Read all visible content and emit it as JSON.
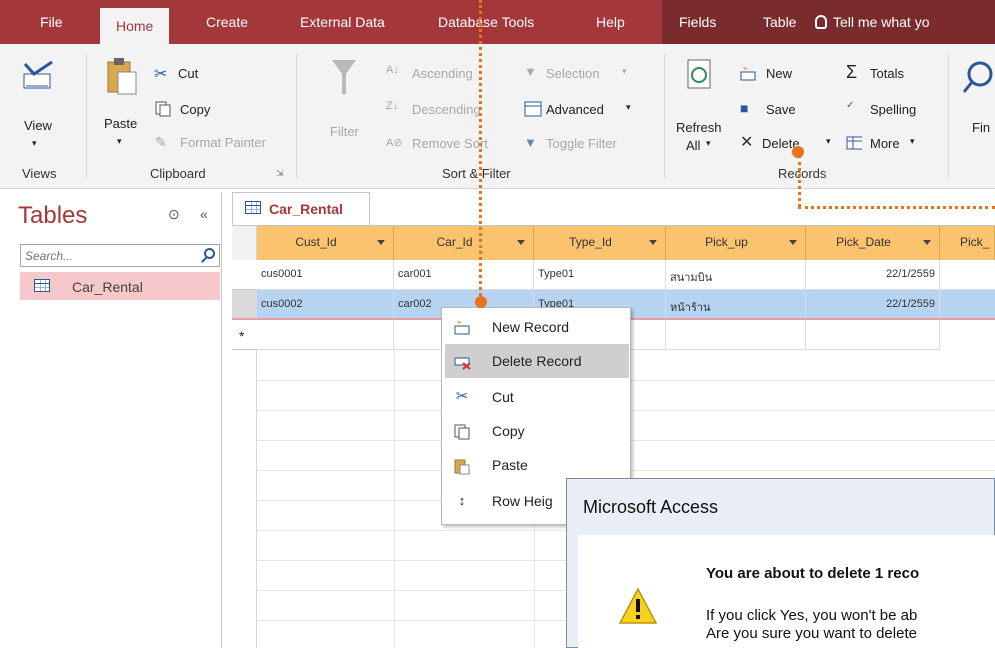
{
  "tabs": [
    {
      "label": "File"
    },
    {
      "label": "Home"
    },
    {
      "label": "Create"
    },
    {
      "label": "External Data"
    },
    {
      "label": "Database Tools"
    },
    {
      "label": "Help"
    },
    {
      "label": "Fields"
    },
    {
      "label": "Table"
    }
  ],
  "tell_me": "Tell me what yo",
  "ribbon": {
    "views": {
      "view": "View",
      "group": "Views"
    },
    "clipboard": {
      "paste": "Paste",
      "cut": "Cut",
      "copy": "Copy",
      "format_painter": "Format Painter",
      "group": "Clipboard"
    },
    "sort_filter": {
      "filter": "Filter",
      "ascending": "Ascending",
      "descending": "Descending",
      "remove_sort": "Remove Sort",
      "selection": "Selection",
      "advanced": "Advanced",
      "toggle_filter": "Toggle Filter",
      "group": "Sort & Filter"
    },
    "records": {
      "refresh": "Refresh",
      "all": "All",
      "new": "New",
      "save": "Save",
      "delete": "Delete",
      "totals": "Totals",
      "spelling": "Spelling",
      "more": "More",
      "group": "Records"
    },
    "find": {
      "find": "Fin"
    }
  },
  "nav": {
    "title": "Tables",
    "search_placeholder": "Search...",
    "items": [
      {
        "label": "Car_Rental"
      }
    ]
  },
  "document": {
    "tab": "Car_Rental"
  },
  "table": {
    "columns": [
      "Cust_Id",
      "Car_Id",
      "Type_Id",
      "Pick_up",
      "Pick_Date",
      "Pick_"
    ],
    "rows": [
      [
        "cus0001",
        "car001",
        "Type01",
        "สนามบิน",
        "22/1/2559"
      ],
      [
        "cus0002",
        "car002",
        "Type01",
        "หน้าร้าน",
        "22/1/2559"
      ]
    ],
    "new_row_marker": "*"
  },
  "context_menu": {
    "items": [
      {
        "label": "New Record",
        "icon": "new-record-icon"
      },
      {
        "label": "Delete Record",
        "icon": "delete-record-icon"
      },
      {
        "label": "Cut",
        "icon": "scissors-icon"
      },
      {
        "label": "Copy",
        "icon": "copy-icon"
      },
      {
        "label": "Paste",
        "icon": "paste-icon"
      },
      {
        "label": "Row Heig",
        "icon": "row-height-icon"
      }
    ]
  },
  "dialog": {
    "title": "Microsoft Access",
    "heading": "You are about to delete 1 reco",
    "line1": "If you click Yes, you won't be ab",
    "line2": "Are you sure you want to delete",
    "icon": "warning-icon"
  },
  "colors": {
    "accent": "#a4373a",
    "header": "#fbc36e",
    "selected_row": "#b6d4f2",
    "annotation": "#e8731a"
  }
}
